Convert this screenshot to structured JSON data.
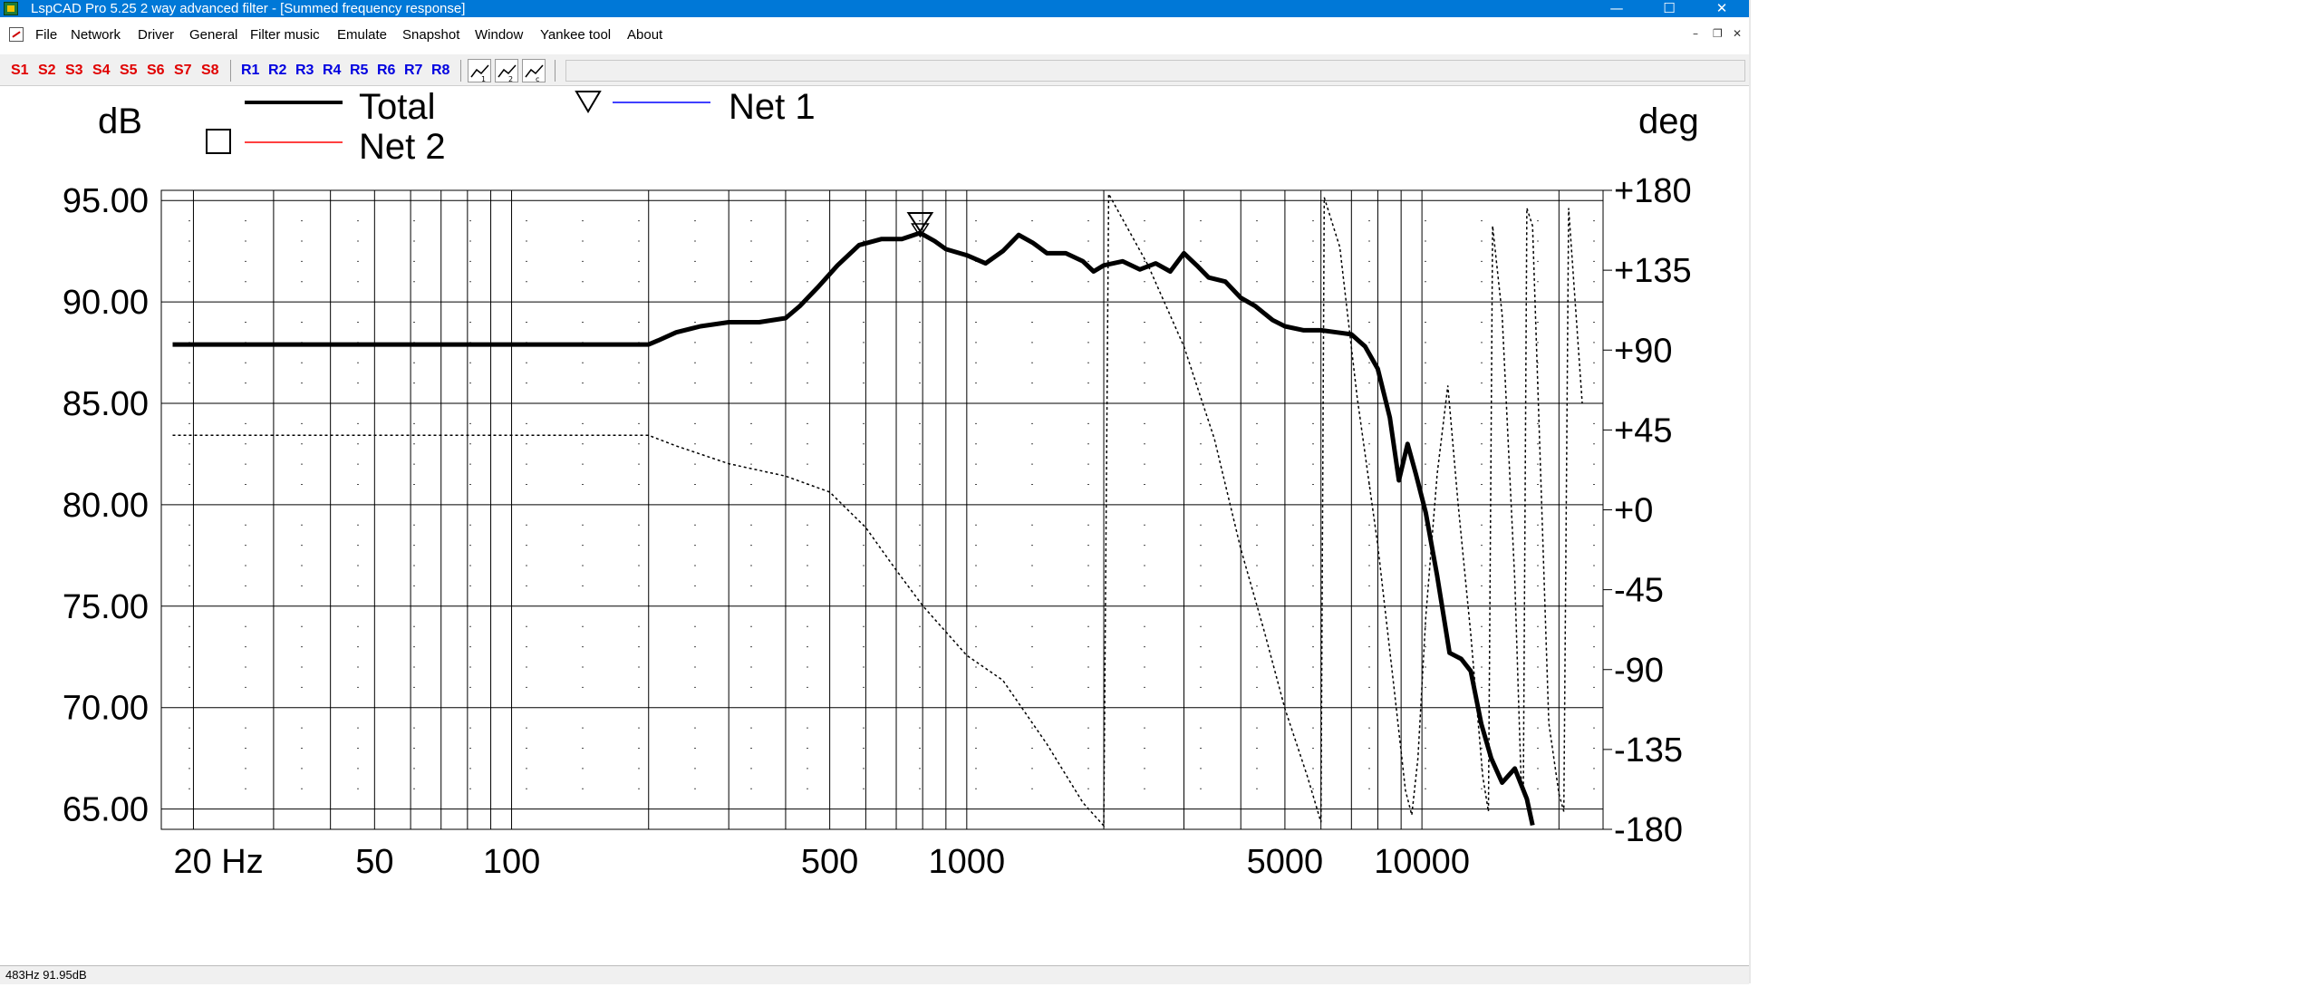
{
  "window": {
    "title": "LspCAD Pro 5.25 2 way advanced filter - [Summed frequency response]",
    "minimize": "—",
    "maximize": "☐",
    "close": "✕"
  },
  "menu": {
    "items": [
      "File",
      "Network",
      "Driver",
      "General",
      "Filter music",
      "Emulate",
      "Snapshot",
      "Window",
      "Yankee tool",
      "About"
    ],
    "mdi_minimize": "–",
    "mdi_restore": "❐",
    "mdi_close": "✕"
  },
  "toolbar": {
    "snapshot_buttons": [
      "S1",
      "S2",
      "S3",
      "S4",
      "S5",
      "S6",
      "S7",
      "S8"
    ],
    "recall_buttons": [
      "R1",
      "R2",
      "R3",
      "R4",
      "R5",
      "R6",
      "R7",
      "R8"
    ],
    "tool_icons": [
      "curve-a-icon",
      "curve-b-icon",
      "curve-c-icon"
    ],
    "input_value": ""
  },
  "status": {
    "text": "483Hz  91.95dB"
  },
  "colors": {
    "titlebar": "#0078d7",
    "total": "#000000",
    "net1": "#0000ff",
    "net2": "#ff0000",
    "grid": "#000000"
  },
  "chart_data": {
    "type": "line",
    "title": "",
    "xlabel": "",
    "ylabel": "dB",
    "y2label": "deg",
    "xscale": "log",
    "xlim": [
      17,
      25000
    ],
    "ylim": [
      64,
      95.5
    ],
    "y2lim": [
      -180,
      180
    ],
    "x_tick_labels": [
      "20 Hz",
      "50",
      "100",
      "500",
      "1000",
      "5000",
      "10000"
    ],
    "x_tick_values": [
      20,
      50,
      100,
      500,
      1000,
      5000,
      10000
    ],
    "y_tick_labels": [
      "95.00",
      "90.00",
      "85.00",
      "80.00",
      "75.00",
      "70.00",
      "65.00"
    ],
    "y_tick_values": [
      95,
      90,
      85,
      80,
      75,
      70,
      65
    ],
    "y2_tick_labels": [
      "+180",
      "+135",
      "+90",
      "+45",
      "+0",
      "-45",
      "-90",
      "-135",
      "-180"
    ],
    "y2_tick_values": [
      180,
      135,
      90,
      45,
      0,
      -45,
      -90,
      -135,
      -180
    ],
    "grid": true,
    "legend": [
      {
        "name": "Total",
        "marker": "line"
      },
      {
        "name": "Net 1",
        "marker": "triangle"
      },
      {
        "name": "Net 2",
        "marker": "square"
      }
    ],
    "series": [
      {
        "name": "Total",
        "axis": "dB",
        "style": "solid-thick",
        "points": [
          [
            18,
            87.9
          ],
          [
            100,
            87.9
          ],
          [
            200,
            87.9
          ],
          [
            210,
            88.1
          ],
          [
            230,
            88.5
          ],
          [
            260,
            88.8
          ],
          [
            300,
            89.0
          ],
          [
            350,
            89.0
          ],
          [
            400,
            89.2
          ],
          [
            430,
            89.8
          ],
          [
            470,
            90.7
          ],
          [
            520,
            91.8
          ],
          [
            580,
            92.8
          ],
          [
            650,
            93.1
          ],
          [
            720,
            93.1
          ],
          [
            790,
            93.4
          ],
          [
            850,
            93.0
          ],
          [
            900,
            92.6
          ],
          [
            1000,
            92.3
          ],
          [
            1100,
            91.9
          ],
          [
            1200,
            92.5
          ],
          [
            1300,
            93.3
          ],
          [
            1400,
            92.9
          ],
          [
            1500,
            92.4
          ],
          [
            1650,
            92.4
          ],
          [
            1800,
            92.0
          ],
          [
            1900,
            91.5
          ],
          [
            2000,
            91.8
          ],
          [
            2200,
            92.0
          ],
          [
            2400,
            91.6
          ],
          [
            2600,
            91.9
          ],
          [
            2800,
            91.5
          ],
          [
            3000,
            92.4
          ],
          [
            3200,
            91.8
          ],
          [
            3400,
            91.2
          ],
          [
            3700,
            91.0
          ],
          [
            4000,
            90.2
          ],
          [
            4300,
            89.8
          ],
          [
            4700,
            89.1
          ],
          [
            5000,
            88.8
          ],
          [
            5500,
            88.6
          ],
          [
            6000,
            88.6
          ],
          [
            6500,
            88.5
          ],
          [
            7000,
            88.4
          ],
          [
            7500,
            87.8
          ],
          [
            8000,
            86.7
          ],
          [
            8500,
            84.3
          ],
          [
            8900,
            81.2
          ],
          [
            9300,
            83.0
          ],
          [
            9700,
            81.5
          ],
          [
            10200,
            79.6
          ],
          [
            10800,
            76.5
          ],
          [
            11500,
            72.7
          ],
          [
            12200,
            72.4
          ],
          [
            12800,
            71.8
          ],
          [
            13500,
            69.2
          ],
          [
            14200,
            67.5
          ],
          [
            15000,
            66.3
          ],
          [
            16000,
            67.0
          ],
          [
            17000,
            65.5
          ],
          [
            17500,
            64.2
          ]
        ]
      },
      {
        "name": "Phase",
        "axis": "deg",
        "style": "dotted",
        "points": [
          [
            18,
            42
          ],
          [
            100,
            42
          ],
          [
            200,
            42
          ],
          [
            230,
            36
          ],
          [
            300,
            26
          ],
          [
            400,
            19
          ],
          [
            500,
            10
          ],
          [
            600,
            -10
          ],
          [
            700,
            -34
          ],
          [
            800,
            -54
          ],
          [
            1000,
            -82
          ],
          [
            1200,
            -96
          ],
          [
            1500,
            -132
          ],
          [
            1800,
            -165
          ],
          [
            2000,
            -178
          ],
          [
            2050,
            178
          ],
          [
            2500,
            138
          ],
          [
            3000,
            92
          ],
          [
            3500,
            40
          ],
          [
            4000,
            -22
          ],
          [
            4500,
            -68
          ],
          [
            5000,
            -112
          ],
          [
            5600,
            -150
          ],
          [
            6000,
            -176
          ],
          [
            6100,
            176
          ],
          [
            6600,
            148
          ],
          [
            7200,
            64
          ],
          [
            8000,
            -20
          ],
          [
            8700,
            -102
          ],
          [
            9200,
            -158
          ],
          [
            9500,
            -172
          ],
          [
            9800,
            -140
          ],
          [
            10200,
            -60
          ],
          [
            10800,
            20
          ],
          [
            11400,
            70
          ],
          [
            12000,
            4
          ],
          [
            12800,
            -70
          ],
          [
            13600,
            -150
          ],
          [
            14000,
            -170
          ],
          [
            14300,
            160
          ],
          [
            15000,
            110
          ],
          [
            16000,
            -40
          ],
          [
            16500,
            -150
          ],
          [
            16700,
            -160
          ],
          [
            17000,
            170
          ],
          [
            17500,
            160
          ],
          [
            19000,
            -120
          ],
          [
            20000,
            -160
          ],
          [
            20500,
            -170
          ],
          [
            21000,
            170
          ],
          [
            22500,
            60
          ]
        ]
      }
    ],
    "marker": {
      "name": "Net 1",
      "shape": "triangle",
      "x": 790,
      "y": 93.4
    }
  }
}
